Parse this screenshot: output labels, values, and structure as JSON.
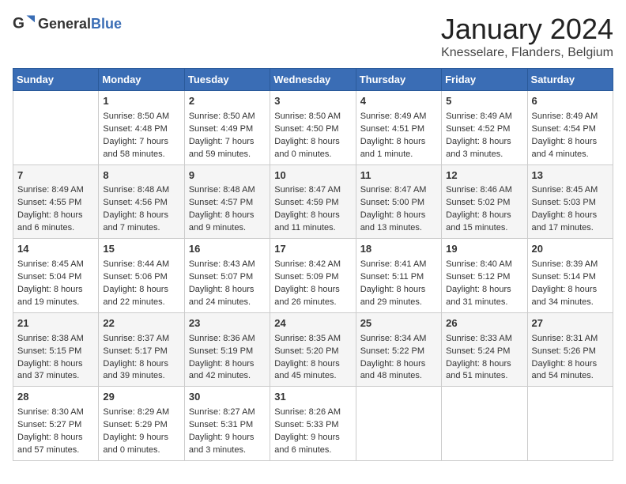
{
  "header": {
    "logo_general": "General",
    "logo_blue": "Blue",
    "month": "January 2024",
    "location": "Knesselare, Flanders, Belgium"
  },
  "weekdays": [
    "Sunday",
    "Monday",
    "Tuesday",
    "Wednesday",
    "Thursday",
    "Friday",
    "Saturday"
  ],
  "weeks": [
    [
      {
        "day": "",
        "content": ""
      },
      {
        "day": "1",
        "content": "Sunrise: 8:50 AM\nSunset: 4:48 PM\nDaylight: 7 hours\nand 58 minutes."
      },
      {
        "day": "2",
        "content": "Sunrise: 8:50 AM\nSunset: 4:49 PM\nDaylight: 7 hours\nand 59 minutes."
      },
      {
        "day": "3",
        "content": "Sunrise: 8:50 AM\nSunset: 4:50 PM\nDaylight: 8 hours\nand 0 minutes."
      },
      {
        "day": "4",
        "content": "Sunrise: 8:49 AM\nSunset: 4:51 PM\nDaylight: 8 hours\nand 1 minute."
      },
      {
        "day": "5",
        "content": "Sunrise: 8:49 AM\nSunset: 4:52 PM\nDaylight: 8 hours\nand 3 minutes."
      },
      {
        "day": "6",
        "content": "Sunrise: 8:49 AM\nSunset: 4:54 PM\nDaylight: 8 hours\nand 4 minutes."
      }
    ],
    [
      {
        "day": "7",
        "content": "Sunrise: 8:49 AM\nSunset: 4:55 PM\nDaylight: 8 hours\nand 6 minutes."
      },
      {
        "day": "8",
        "content": "Sunrise: 8:48 AM\nSunset: 4:56 PM\nDaylight: 8 hours\nand 7 minutes."
      },
      {
        "day": "9",
        "content": "Sunrise: 8:48 AM\nSunset: 4:57 PM\nDaylight: 8 hours\nand 9 minutes."
      },
      {
        "day": "10",
        "content": "Sunrise: 8:47 AM\nSunset: 4:59 PM\nDaylight: 8 hours\nand 11 minutes."
      },
      {
        "day": "11",
        "content": "Sunrise: 8:47 AM\nSunset: 5:00 PM\nDaylight: 8 hours\nand 13 minutes."
      },
      {
        "day": "12",
        "content": "Sunrise: 8:46 AM\nSunset: 5:02 PM\nDaylight: 8 hours\nand 15 minutes."
      },
      {
        "day": "13",
        "content": "Sunrise: 8:45 AM\nSunset: 5:03 PM\nDaylight: 8 hours\nand 17 minutes."
      }
    ],
    [
      {
        "day": "14",
        "content": "Sunrise: 8:45 AM\nSunset: 5:04 PM\nDaylight: 8 hours\nand 19 minutes."
      },
      {
        "day": "15",
        "content": "Sunrise: 8:44 AM\nSunset: 5:06 PM\nDaylight: 8 hours\nand 22 minutes."
      },
      {
        "day": "16",
        "content": "Sunrise: 8:43 AM\nSunset: 5:07 PM\nDaylight: 8 hours\nand 24 minutes."
      },
      {
        "day": "17",
        "content": "Sunrise: 8:42 AM\nSunset: 5:09 PM\nDaylight: 8 hours\nand 26 minutes."
      },
      {
        "day": "18",
        "content": "Sunrise: 8:41 AM\nSunset: 5:11 PM\nDaylight: 8 hours\nand 29 minutes."
      },
      {
        "day": "19",
        "content": "Sunrise: 8:40 AM\nSunset: 5:12 PM\nDaylight: 8 hours\nand 31 minutes."
      },
      {
        "day": "20",
        "content": "Sunrise: 8:39 AM\nSunset: 5:14 PM\nDaylight: 8 hours\nand 34 minutes."
      }
    ],
    [
      {
        "day": "21",
        "content": "Sunrise: 8:38 AM\nSunset: 5:15 PM\nDaylight: 8 hours\nand 37 minutes."
      },
      {
        "day": "22",
        "content": "Sunrise: 8:37 AM\nSunset: 5:17 PM\nDaylight: 8 hours\nand 39 minutes."
      },
      {
        "day": "23",
        "content": "Sunrise: 8:36 AM\nSunset: 5:19 PM\nDaylight: 8 hours\nand 42 minutes."
      },
      {
        "day": "24",
        "content": "Sunrise: 8:35 AM\nSunset: 5:20 PM\nDaylight: 8 hours\nand 45 minutes."
      },
      {
        "day": "25",
        "content": "Sunrise: 8:34 AM\nSunset: 5:22 PM\nDaylight: 8 hours\nand 48 minutes."
      },
      {
        "day": "26",
        "content": "Sunrise: 8:33 AM\nSunset: 5:24 PM\nDaylight: 8 hours\nand 51 minutes."
      },
      {
        "day": "27",
        "content": "Sunrise: 8:31 AM\nSunset: 5:26 PM\nDaylight: 8 hours\nand 54 minutes."
      }
    ],
    [
      {
        "day": "28",
        "content": "Sunrise: 8:30 AM\nSunset: 5:27 PM\nDaylight: 8 hours\nand 57 minutes."
      },
      {
        "day": "29",
        "content": "Sunrise: 8:29 AM\nSunset: 5:29 PM\nDaylight: 9 hours\nand 0 minutes."
      },
      {
        "day": "30",
        "content": "Sunrise: 8:27 AM\nSunset: 5:31 PM\nDaylight: 9 hours\nand 3 minutes."
      },
      {
        "day": "31",
        "content": "Sunrise: 8:26 AM\nSunset: 5:33 PM\nDaylight: 9 hours\nand 6 minutes."
      },
      {
        "day": "",
        "content": ""
      },
      {
        "day": "",
        "content": ""
      },
      {
        "day": "",
        "content": ""
      }
    ]
  ]
}
